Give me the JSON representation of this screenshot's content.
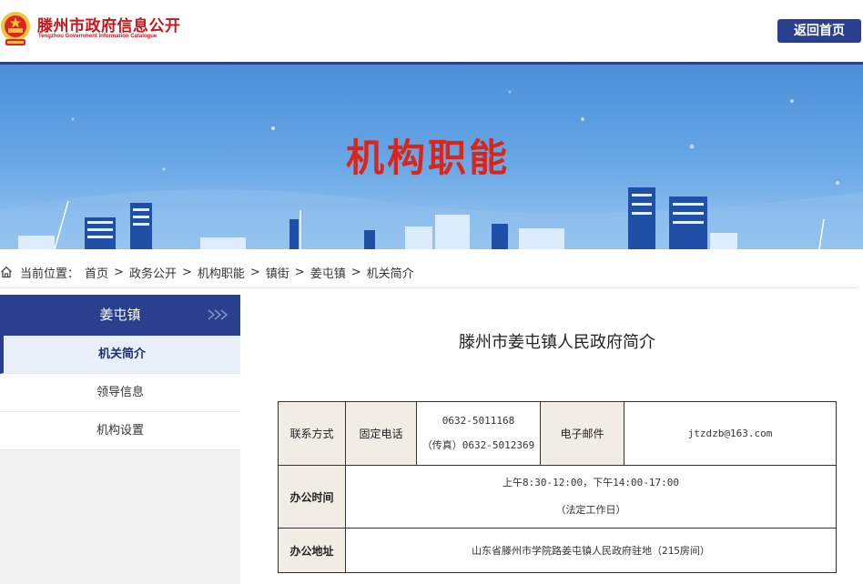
{
  "header": {
    "logo_cn": "滕州市政府信息公开",
    "logo_en": "Tengzhou Government Information Catalogue",
    "back_button": "返回首页"
  },
  "banner": {
    "title": "机构职能"
  },
  "breadcrumb": {
    "label": "当前位置：",
    "items": [
      "首页",
      "政务公开",
      "机构职能",
      "镇街",
      "姜屯镇",
      "机关简介"
    ],
    "separator": ">"
  },
  "sidebar": {
    "heading": "姜屯镇",
    "items": [
      {
        "label": "机关简介",
        "active": true
      },
      {
        "label": "领导信息",
        "active": false
      },
      {
        "label": "机构设置",
        "active": false
      }
    ]
  },
  "content": {
    "title": "滕州市姜屯镇人民政府简介",
    "table": {
      "contact_label": "联系方式",
      "phone_label": "固定电话",
      "phone": "0632-5011168",
      "fax": "（传真）0632-5012369",
      "email_label": "电子邮件",
      "email": "jtzdzb@163.com",
      "hours_label": "办公时间",
      "hours": "上午8:30-12:00，下午14:00-17:00",
      "hours_note": "（法定工作日）",
      "address_label": "办公地址",
      "address": "山东省滕州市学院路姜屯镇人民政府驻地（215房间）"
    }
  },
  "colors": {
    "brand_blue": "#2a3f8e",
    "brand_red": "#c8161d",
    "header_cell_bg": "#f1ede4"
  },
  "icons": [
    "national-emblem-icon",
    "home-icon",
    "double-chevron-right-icon"
  ]
}
